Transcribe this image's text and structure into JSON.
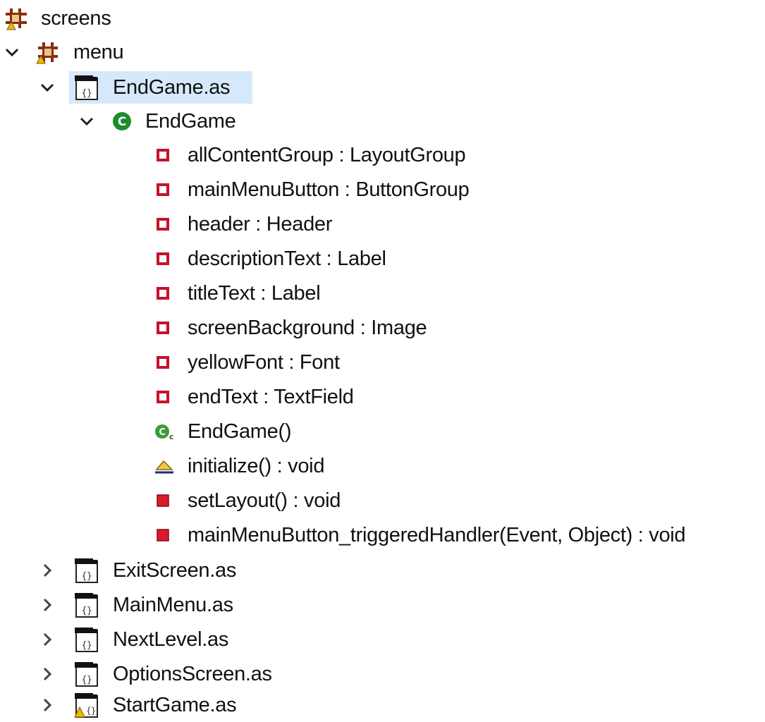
{
  "tree": {
    "screens_label": "screens",
    "menu_label": "menu",
    "endgame_file_label": "EndGame.as",
    "endgame_class_label": "EndGame",
    "members": [
      {
        "label": "allContentGroup : LayoutGroup",
        "kind": "private-field"
      },
      {
        "label": "mainMenuButton : ButtonGroup",
        "kind": "private-field"
      },
      {
        "label": "header : Header",
        "kind": "private-field"
      },
      {
        "label": "descriptionText : Label",
        "kind": "private-field"
      },
      {
        "label": "titleText : Label",
        "kind": "private-field"
      },
      {
        "label": "screenBackground : Image",
        "kind": "private-field"
      },
      {
        "label": "yellowFont : Font",
        "kind": "private-field"
      },
      {
        "label": "endText : TextField",
        "kind": "private-field"
      },
      {
        "label": "EndGame()",
        "kind": "constructor"
      },
      {
        "label": "initialize() : void",
        "kind": "override-method"
      },
      {
        "label": "setLayout() : void",
        "kind": "private-method"
      },
      {
        "label": "mainMenuButton_triggeredHandler(Event, Object) : void",
        "kind": "private-method"
      }
    ],
    "files": [
      {
        "label": "ExitScreen.as",
        "warning": false
      },
      {
        "label": "MainMenu.as",
        "warning": false
      },
      {
        "label": "NextLevel.as",
        "warning": false
      },
      {
        "label": "OptionsScreen.as",
        "warning": false
      },
      {
        "label": "StartGame.as",
        "warning": true
      }
    ]
  },
  "colors": {
    "selection": "#d6e8fb",
    "private_member": "#c8102e",
    "class_icon": "#1f8b2b",
    "package_icon": "#8b2c0c",
    "warning": "#f2b705"
  }
}
